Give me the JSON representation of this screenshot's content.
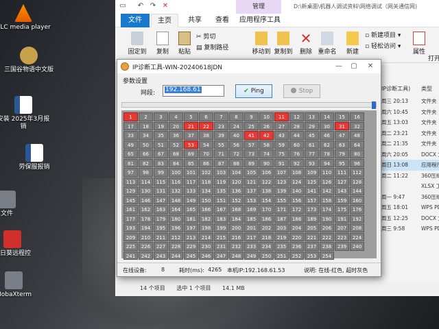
{
  "desktop": {
    "icons": [
      {
        "label": "VLC media player",
        "glyph": "vlc-cone-icon"
      },
      {
        "label": "三国谷物语中文版",
        "glyph": "game-icon"
      },
      {
        "label": "安装 2025年3月报销",
        "glyph": "word-doc-icon"
      },
      {
        "label": "劳保服报销",
        "glyph": "word-doc-icon"
      },
      {
        "label": "文件",
        "glyph": "folder-icon"
      },
      {
        "label": "向日葵远程控",
        "glyph": "sunlogin-icon"
      },
      {
        "label": "MobaXterm",
        "glyph": "terminal-icon"
      }
    ]
  },
  "explorer": {
    "manage_tab": "管理",
    "path": "D:\\新桌面\\机器人调试资料\\网络调试（网关通信网)",
    "tabs": [
      "文件",
      "主页",
      "共享",
      "查看",
      "应用程序工具"
    ],
    "ribbon": {
      "pin": "固定到",
      "copy": "复制",
      "paste": "粘贴",
      "cut": "剪切",
      "copy_path": "复制路径",
      "move_to": "移动到",
      "copy_to": "复制到",
      "delete": "删除",
      "rename": "重命名",
      "new": "新建",
      "new_item": "新建项目",
      "easy_access": "轻松访问",
      "properties": "属性",
      "open": "打开"
    },
    "col_header": "IP诊断工具)",
    "type_header": "类型",
    "files": [
      {
        "date": "周三 20:13",
        "type": "文件夹"
      },
      {
        "date": "周六 10:45",
        "type": "文件夹"
      },
      {
        "date": "周五 13:03",
        "type": "文件夹"
      },
      {
        "date": "周二 23:21",
        "type": "文件夹"
      },
      {
        "date": "周二 21:35",
        "type": "文件夹"
      },
      {
        "date": "周六 20:05",
        "type": "DOCX 文"
      },
      {
        "date": "周日 13:08",
        "type": "应用程序"
      },
      {
        "date": "周二 11:22",
        "type": "360压缩"
      },
      {
        "date": "",
        "type": "XLSX 工作"
      },
      {
        "date": "周一 9:47",
        "type": "360压缩"
      },
      {
        "date": "周五 18:01",
        "type": "WPS PDF"
      },
      {
        "date": "周五 12:25",
        "type": "DOCX 文"
      },
      {
        "date": "周三 9:58",
        "type": "WPS PDF"
      }
    ],
    "status": {
      "count": "14 个项目",
      "selected": "选中 1 个项目",
      "size": "14.1 MB"
    }
  },
  "dialog": {
    "title": "IP诊断工具-WIN-20240618JDN",
    "param_label": "参数设置",
    "net_label": "网段:",
    "ip_value": "192.168.61",
    "ping_label": "Ping",
    "stop_label": "Stop",
    "progress": 1.0,
    "grid": {
      "cells": [
        1,
        2,
        3,
        4,
        5,
        6,
        7,
        8,
        9,
        10,
        11,
        12,
        13,
        14,
        15,
        16,
        17,
        18,
        19,
        20,
        21,
        22,
        23,
        24,
        25,
        26,
        27,
        28,
        29,
        30,
        31,
        32,
        33,
        34,
        35,
        36,
        37,
        38,
        39,
        40,
        41,
        42,
        43,
        44,
        45,
        46,
        47,
        48,
        49,
        50,
        51,
        52,
        53,
        54,
        55,
        56,
        57,
        58,
        59,
        60,
        61,
        62,
        63,
        64,
        65,
        66,
        67,
        68,
        69,
        70,
        71,
        72,
        73,
        74,
        75,
        76,
        77,
        78,
        79,
        80,
        81,
        82,
        83,
        84,
        85,
        86,
        87,
        88,
        89,
        90,
        91,
        92,
        93,
        94,
        95,
        96,
        97,
        98,
        99,
        100,
        101,
        102,
        103,
        104,
        105,
        106,
        107,
        108,
        109,
        110,
        111,
        112,
        113,
        114,
        115,
        116,
        117,
        118,
        119,
        120,
        121,
        122,
        123,
        124,
        125,
        126,
        127,
        128,
        129,
        130,
        131,
        132,
        133,
        134,
        135,
        136,
        137,
        138,
        139,
        140,
        141,
        142,
        143,
        144,
        145,
        146,
        147,
        148,
        149,
        150,
        151,
        152,
        153,
        154,
        155,
        156,
        157,
        158,
        159,
        160,
        161,
        162,
        163,
        164,
        165,
        166,
        167,
        168,
        169,
        170,
        171,
        172,
        173,
        174,
        175,
        176,
        177,
        178,
        179,
        180,
        181,
        182,
        183,
        184,
        185,
        186,
        187,
        188,
        189,
        190,
        191,
        192,
        193,
        194,
        195,
        196,
        197,
        198,
        199,
        200,
        201,
        202,
        203,
        204,
        205,
        206,
        207,
        208,
        209,
        210,
        211,
        212,
        213,
        214,
        215,
        216,
        217,
        218,
        219,
        220,
        221,
        222,
        223,
        224,
        225,
        226,
        227,
        228,
        229,
        230,
        231,
        232,
        233,
        234,
        235,
        236,
        237,
        238,
        239,
        240,
        241,
        242,
        243,
        244,
        245,
        246,
        247,
        248,
        249,
        250,
        251,
        252,
        253,
        254
      ],
      "online": [
        1,
        11,
        21,
        22,
        31,
        41,
        42,
        53
      ],
      "online_color": "#e53935",
      "offline_color": "#7f7f7f"
    },
    "status": {
      "online_label": "在线设备:",
      "online_count": "8",
      "time_label": "耗时(ms):",
      "time_value": "4265",
      "local_ip": "本机IP:192.168.61.53",
      "legend": "说明: 在线-红色, 超时灰色"
    }
  }
}
